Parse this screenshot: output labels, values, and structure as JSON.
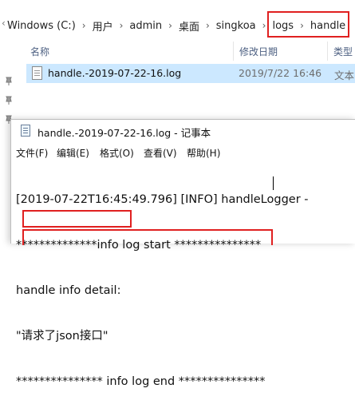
{
  "explorer": {
    "breadcrumb": [
      "Windows (C:)",
      "用户",
      "admin",
      "桌面",
      "singkoa",
      "logs",
      "handle"
    ],
    "breadcrumb_separator": "›",
    "nav_chevron": "‹",
    "columns": {
      "name": "名称",
      "modified": "修改日期",
      "type": "类型"
    },
    "files": [
      {
        "name": "handle.-2019-07-22-16.log",
        "modified": "2019/7/22 16:46",
        "type": "文本"
      }
    ],
    "colors": {
      "selection": "#cce8ff",
      "highlight": "#e02020"
    }
  },
  "notepad": {
    "title": "handle.-2019-07-22-16.log - 记事本",
    "menu": [
      {
        "label": "文件(F)"
      },
      {
        "label": "编辑(E)"
      },
      {
        "label": "格式(O)"
      },
      {
        "label": "查看(V)"
      },
      {
        "label": "帮助(H)"
      }
    ],
    "lines": [
      "[2019-07-22T16:45:49.796] [INFO] handleLogger -",
      "**************info log start ***************",
      "handle info detail:",
      "\"请求了json接口\"",
      "*************** info log end ***************"
    ]
  }
}
